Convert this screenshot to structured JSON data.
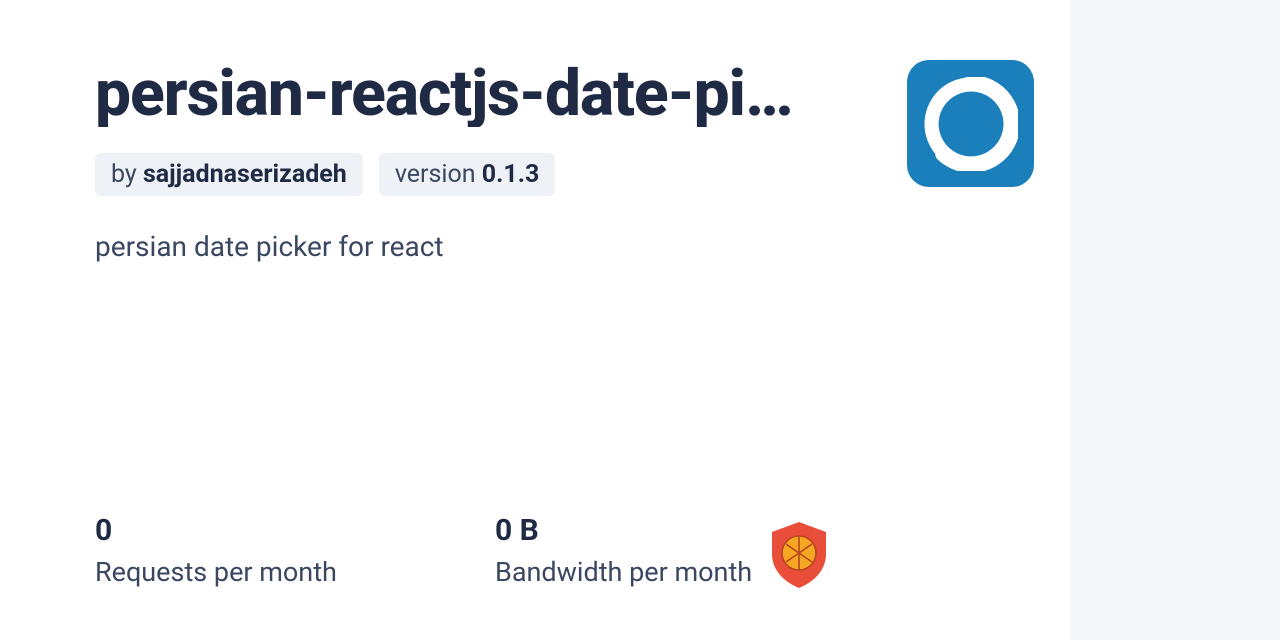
{
  "package": {
    "name": "persian-reactjs-date-pi…",
    "by_prefix": "by ",
    "author": "sajjadnaserizadeh",
    "version_prefix": "version ",
    "version": "0.1.3",
    "description": "persian date picker for react"
  },
  "stats": {
    "requests": {
      "value": "0",
      "label": "Requests per month"
    },
    "bandwidth": {
      "value": "0 B",
      "label": "Bandwidth per month"
    }
  }
}
